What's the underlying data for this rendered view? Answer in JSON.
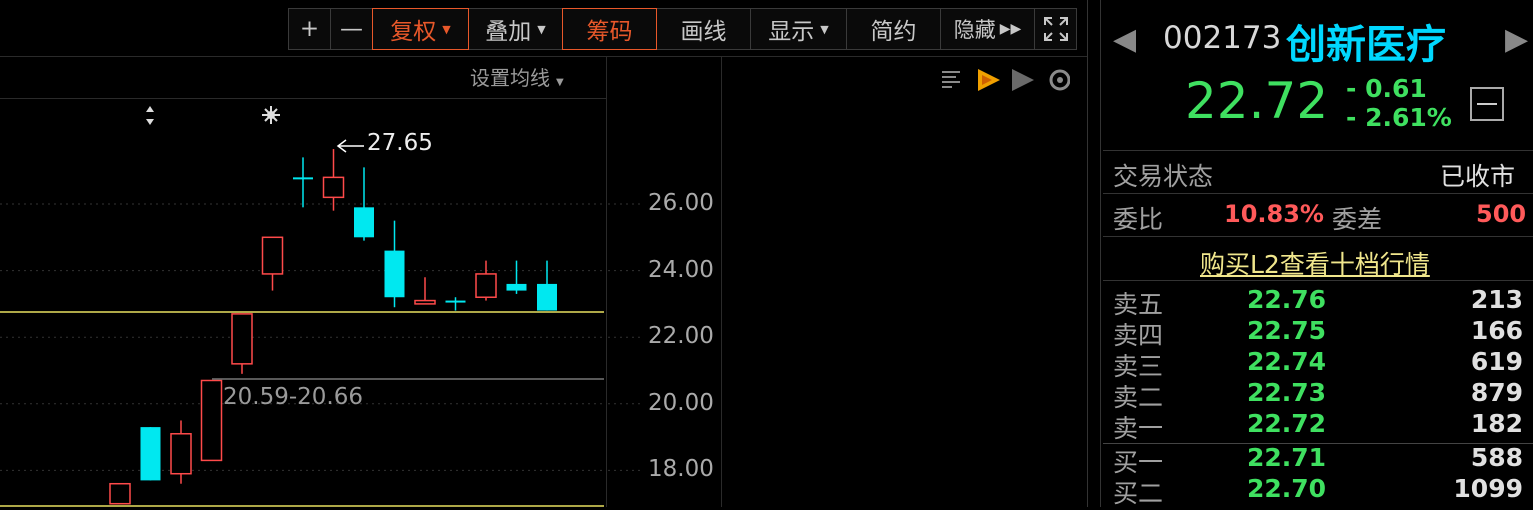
{
  "toolbar": {
    "plus_label": "+",
    "minus_label": "—",
    "fuquan_label": "复权",
    "diejia_label": "叠加",
    "chouma_label": "筹码",
    "huaxian_label": "画线",
    "xianshi_label": "显示",
    "jianyue_label": "简约",
    "yincang_label": "隐藏"
  },
  "chart": {
    "ma_setting_label": "设置均线",
    "high_annotation": "27.65",
    "range_annotation": "20.59-20.66",
    "y_ticks": [
      "26.00",
      "24.00",
      "22.00",
      "20.00",
      "18.00"
    ]
  },
  "chart_data": {
    "type": "candlestick",
    "y_ticks": [
      26.0,
      24.0,
      22.0,
      20.0,
      18.0
    ],
    "current_price_line": 22.72,
    "annotations": {
      "high": "27.65",
      "range": "20.59-20.66"
    },
    "candles": [
      {
        "o": 17.6,
        "c": 17.0,
        "h": 17.6,
        "l": 17.0,
        "dir": "up"
      },
      {
        "o": 19.3,
        "c": 17.7,
        "h": 19.3,
        "l": 17.7,
        "dir": "down"
      },
      {
        "o": 17.9,
        "c": 19.1,
        "h": 19.5,
        "l": 17.6,
        "dir": "up"
      },
      {
        "o": 18.3,
        "c": 20.7,
        "h": 20.7,
        "l": 18.3,
        "dir": "up"
      },
      {
        "o": 21.2,
        "c": 22.7,
        "h": 22.7,
        "l": 20.9,
        "dir": "up"
      },
      {
        "o": 23.9,
        "c": 25.0,
        "h": 25.0,
        "l": 23.4,
        "dir": "up"
      },
      {
        "o": 26.8,
        "c": 26.8,
        "h": 27.4,
        "l": 25.9,
        "dir": "down"
      },
      {
        "o": 26.2,
        "c": 26.8,
        "h": 27.65,
        "l": 25.8,
        "dir": "up"
      },
      {
        "o": 25.9,
        "c": 25.0,
        "h": 27.1,
        "l": 24.9,
        "dir": "down"
      },
      {
        "o": 24.6,
        "c": 23.2,
        "h": 25.5,
        "l": 22.9,
        "dir": "down"
      },
      {
        "o": 23.1,
        "c": 23.0,
        "h": 23.8,
        "l": 23.0,
        "dir": "up"
      },
      {
        "o": 23.1,
        "c": 23.1,
        "h": 23.2,
        "l": 22.8,
        "dir": "down"
      },
      {
        "o": 23.2,
        "c": 23.9,
        "h": 24.3,
        "l": 23.1,
        "dir": "up"
      },
      {
        "o": 23.6,
        "c": 23.4,
        "h": 24.3,
        "l": 23.3,
        "dir": "down"
      },
      {
        "o": 23.6,
        "c": 22.8,
        "h": 24.3,
        "l": 22.8,
        "dir": "down"
      }
    ]
  },
  "stock": {
    "code": "002173",
    "name": "创新医疗",
    "price": "22.72",
    "change": "- 0.61",
    "change_pct": "- 2.61%"
  },
  "status": {
    "trade_status_label": "交易状态",
    "trade_status_value": "已收市",
    "weibi_label": "委比",
    "weibi_value": "10.83%",
    "weicha_label": "委差",
    "weicha_value": "500",
    "l2_link": "购买L2查看十档行情"
  },
  "orderbook": [
    {
      "label": "卖五",
      "price": "22.76",
      "volume": "213"
    },
    {
      "label": "卖四",
      "price": "22.75",
      "volume": "166"
    },
    {
      "label": "卖三",
      "price": "22.74",
      "volume": "619"
    },
    {
      "label": "卖二",
      "price": "22.73",
      "volume": "879"
    },
    {
      "label": "卖一",
      "price": "22.72",
      "volume": "182"
    },
    {
      "label": "买一",
      "price": "22.71",
      "volume": "588"
    },
    {
      "label": "买二",
      "price": "22.70",
      "volume": "1099"
    }
  ],
  "colors": {
    "up": "#ff4a4a",
    "down": "#00e8f0",
    "green": "#3fe060",
    "accent": "#e8582a",
    "name": "#00d8ff",
    "price_line": "#e8e060"
  }
}
